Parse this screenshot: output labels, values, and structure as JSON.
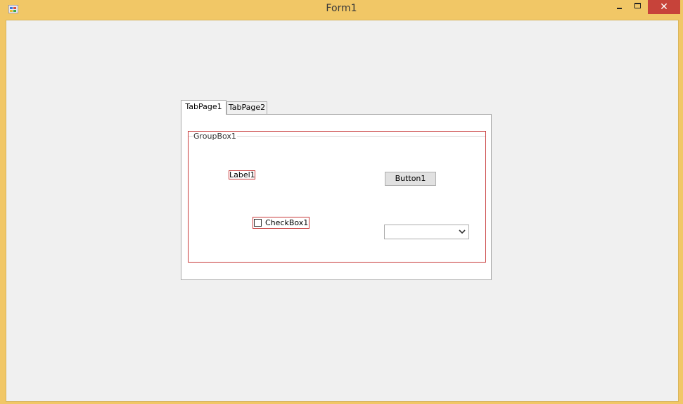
{
  "window": {
    "title": "Form1",
    "close_glyph": "✕",
    "icons": [
      "app-icon",
      "minimize-icon",
      "maximize-icon",
      "close-icon"
    ]
  },
  "tabs": [
    {
      "label": "TabPage1",
      "selected": true
    },
    {
      "label": "TabPage2",
      "selected": false
    }
  ],
  "groupbox": {
    "title": "GroupBox1",
    "label": "Label1",
    "button": "Button1",
    "checkbox": {
      "label": "CheckBox1",
      "checked": false
    },
    "combobox": {
      "value": ""
    }
  },
  "colors": {
    "titlebar": "#f1c766",
    "close_button": "#c7433a",
    "client_background": "#f0f0f0",
    "selection_outline": "#c83a3a"
  }
}
